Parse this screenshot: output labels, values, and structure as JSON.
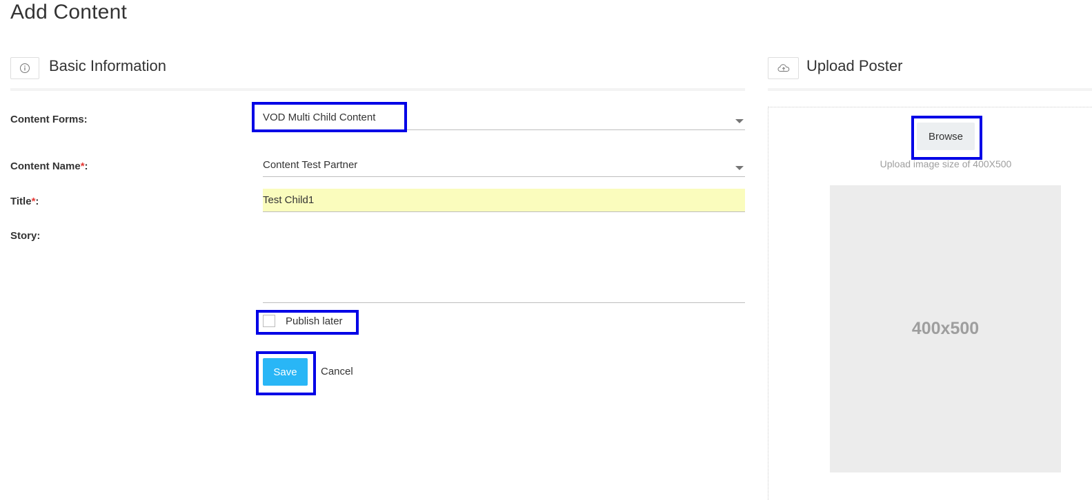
{
  "page": {
    "title": "Add Content"
  },
  "basic_info": {
    "title": "Basic Information",
    "icon": "info-icon"
  },
  "upload": {
    "title": "Upload Poster",
    "icon": "cloud-upload-icon",
    "browse_label": "Browse",
    "hint": "Upload image size of 400X500",
    "placeholder_text": "400x500"
  },
  "form": {
    "content_forms": {
      "label": "Content Forms:",
      "value": "VOD Multi Child Content"
    },
    "content_name": {
      "label": "Content Name",
      "required_mark": "*",
      "suffix": ":",
      "value": "Content Test Partner"
    },
    "title": {
      "label": "Title",
      "required_mark": "*",
      "suffix": ":",
      "value": "Test Child1"
    },
    "story": {
      "label": "Story:",
      "value": ""
    },
    "publish_later": {
      "label": "Publish later",
      "checked": false
    },
    "save_label": "Save",
    "cancel_label": "Cancel"
  },
  "colors": {
    "accent": "#29b6f6",
    "highlight": "#0000e6",
    "title_bg": "#fafcbd",
    "required": "#e53935"
  }
}
